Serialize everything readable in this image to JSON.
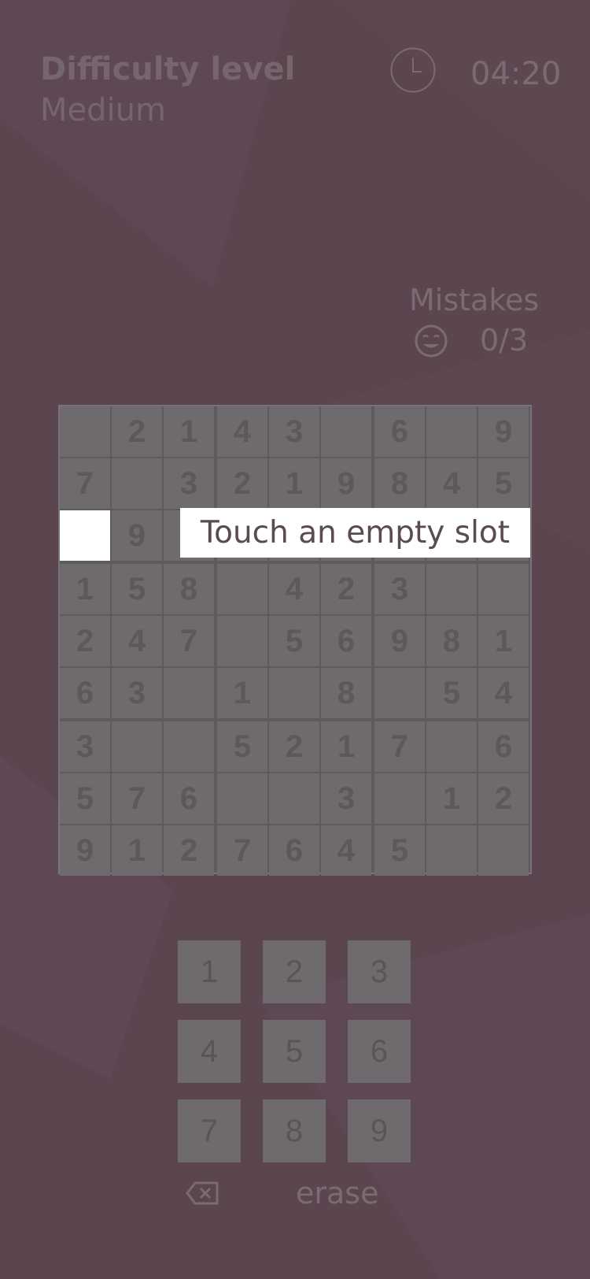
{
  "header": {
    "title": "Difficulty level",
    "difficulty": "Medium"
  },
  "timer": {
    "icon": "clock-icon",
    "value": "04:20"
  },
  "mistakes": {
    "label": "Mistakes",
    "icon": "smiley-icon",
    "count": "0/3"
  },
  "hint": "Touch an empty slot",
  "board": {
    "rows": [
      [
        "",
        "2",
        "1",
        "4",
        "3",
        "",
        "6",
        "",
        "9"
      ],
      [
        "7",
        "",
        "3",
        "2",
        "1",
        "9",
        "8",
        "4",
        "5"
      ],
      [
        "",
        "9",
        "",
        "",
        "",
        "",
        "",
        "",
        ""
      ],
      [
        "1",
        "5",
        "8",
        "",
        "4",
        "2",
        "3",
        "",
        ""
      ],
      [
        "2",
        "4",
        "7",
        "",
        "5",
        "6",
        "9",
        "8",
        "1"
      ],
      [
        "6",
        "3",
        "",
        "1",
        "",
        "8",
        "",
        "5",
        "4"
      ],
      [
        "3",
        "",
        "",
        "5",
        "2",
        "1",
        "7",
        "",
        "6"
      ],
      [
        "5",
        "7",
        "6",
        "",
        "",
        "3",
        "",
        "1",
        "2"
      ],
      [
        "9",
        "1",
        "2",
        "7",
        "6",
        "4",
        "5",
        "",
        ""
      ]
    ],
    "selected": {
      "row": 2,
      "col": 0
    }
  },
  "keypad": {
    "keys": [
      "1",
      "2",
      "3",
      "4",
      "5",
      "6",
      "7",
      "8",
      "9"
    ]
  },
  "erase": {
    "icon": "backspace-icon",
    "label": "erase"
  },
  "colors": {
    "background": "#5b4650",
    "cell": "#6f6a6e",
    "digit": "#5d585c",
    "selected": "#ffffff",
    "muted_text": "#7a6b72"
  }
}
